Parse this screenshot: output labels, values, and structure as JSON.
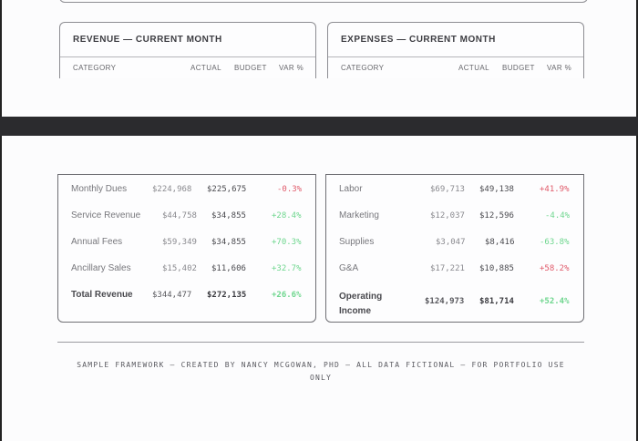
{
  "revenue": {
    "title": "REVENUE — CURRENT MONTH",
    "columns": [
      "CATEGORY",
      "ACTUAL",
      "BUDGET",
      "VAR %"
    ],
    "rows": [
      {
        "category": "Monthly Dues",
        "actual": "$224,968",
        "budget": "$225,675",
        "variance": "-0.3%"
      },
      {
        "category": "Service Revenue",
        "actual": "$44,758",
        "budget": "$34,855",
        "variance": "+28.4%"
      },
      {
        "category": "Annual Fees",
        "actual": "$59,349",
        "budget": "$34,855",
        "variance": "+70.3%"
      },
      {
        "category": "Ancillary Sales",
        "actual": "$15,402",
        "budget": "$11,606",
        "variance": "+32.7%"
      },
      {
        "category": "Total Revenue",
        "actual": "$344,477",
        "budget": "$272,135",
        "variance": "+26.6%"
      }
    ]
  },
  "expenses": {
    "title": "EXPENSES — CURRENT MONTH",
    "columns": [
      "CATEGORY",
      "ACTUAL",
      "BUDGET",
      "VAR %"
    ],
    "rows": [
      {
        "category": "Labor",
        "actual": "$69,713",
        "budget": "$49,138",
        "variance": "+41.9%"
      },
      {
        "category": "Marketing",
        "actual": "$12,037",
        "budget": "$12,596",
        "variance": "-4.4%"
      },
      {
        "category": "Supplies",
        "actual": "$3,047",
        "budget": "$8,416",
        "variance": "-63.8%"
      },
      {
        "category": "G&A",
        "actual": "$17,221",
        "budget": "$10,885",
        "variance": "+58.2%"
      },
      {
        "category_line1": "Operating",
        "category_line2": "Income",
        "actual": "$124,973",
        "budget": "$81,714",
        "variance": "+52.4%"
      }
    ]
  },
  "footer": "SAMPLE FRAMEWORK — CREATED BY NANCY MCGOWAN, PHD — ALL DATA FICTIONAL — FOR PORTFOLIO USE ONLY",
  "colors": {
    "negative": "#e05a6a",
    "positive": "#6ed68e",
    "band": "#2b2b2e"
  }
}
